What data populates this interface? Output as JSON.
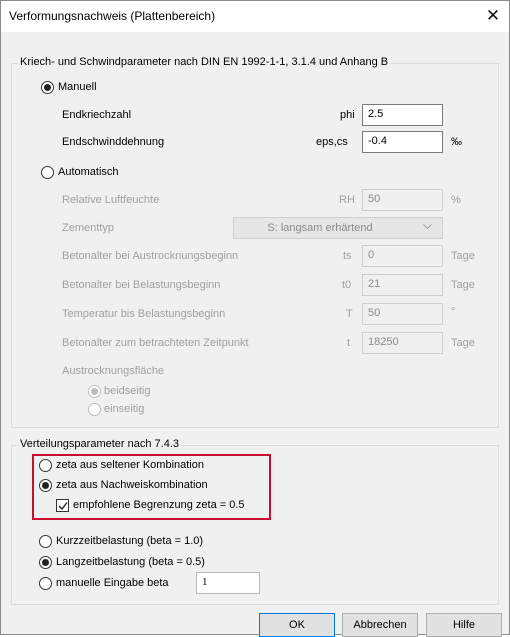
{
  "window": {
    "title": "Verformungsnachweis (Plattenbereich)",
    "close": "✕"
  },
  "kriech": {
    "legend": "Kriech- und Schwindparameter nach DIN EN 1992-1-1, 3.1.4 und Anhang B",
    "manuell_label": "Manuell",
    "endkriechzahl_label": "Endkriechzahl",
    "phi_symbol": "phi",
    "phi_value": "2.5",
    "endschwind_label": "Endschwinddehnung",
    "eps_symbol": "eps,cs",
    "eps_value": "-0.4",
    "eps_unit": "‰",
    "automatisch_label": "Automatisch",
    "rh_label": "Relative Luftfeuchte",
    "rh_symbol": "RH",
    "rh_value": "50",
    "rh_unit": "%",
    "zement_label": "Zementtyp",
    "zement_value": "S: langsam erhärtend",
    "ts_label": "Betonalter bei Austrocknungsbeginn",
    "ts_symbol": "ts",
    "ts_value": "0",
    "ts_unit": "Tage",
    "t0_label": "Betonalter bei Belastungsbeginn",
    "t0_symbol": "t0",
    "t0_value": "21",
    "t0_unit": "Tage",
    "temp_label": "Temperatur bis Belastungsbeginn",
    "temp_symbol": "T",
    "temp_value": "50",
    "temp_unit": "°",
    "t_label": "Betonalter zum betrachteten Zeitpunkt",
    "t_symbol": "t",
    "t_value": "18250",
    "t_unit": "Tage",
    "flaeche_label": "Austrocknungsfläche",
    "beidseitig_label": "beidseitig",
    "einseitig_label": "einseitig"
  },
  "verteilung": {
    "legend": "Verteilungsparameter nach 7.4.3",
    "zeta_selten_label": "zeta aus seltener Kombination",
    "zeta_nachweis_label": "zeta aus Nachweiskombination",
    "begrenzung_label": "empfohlene Begrenzung zeta = 0.5",
    "kurzzeit_label": "Kurzzeitbelastung (beta = 1.0)",
    "langzeit_label": "Langzeitbelastung (beta = 0.5)",
    "manuell_beta_label": "manuelle Eingabe beta",
    "beta_value": "1"
  },
  "buttons": {
    "ok": "OK",
    "cancel": "Abbrechen",
    "help": "Hilfe"
  }
}
